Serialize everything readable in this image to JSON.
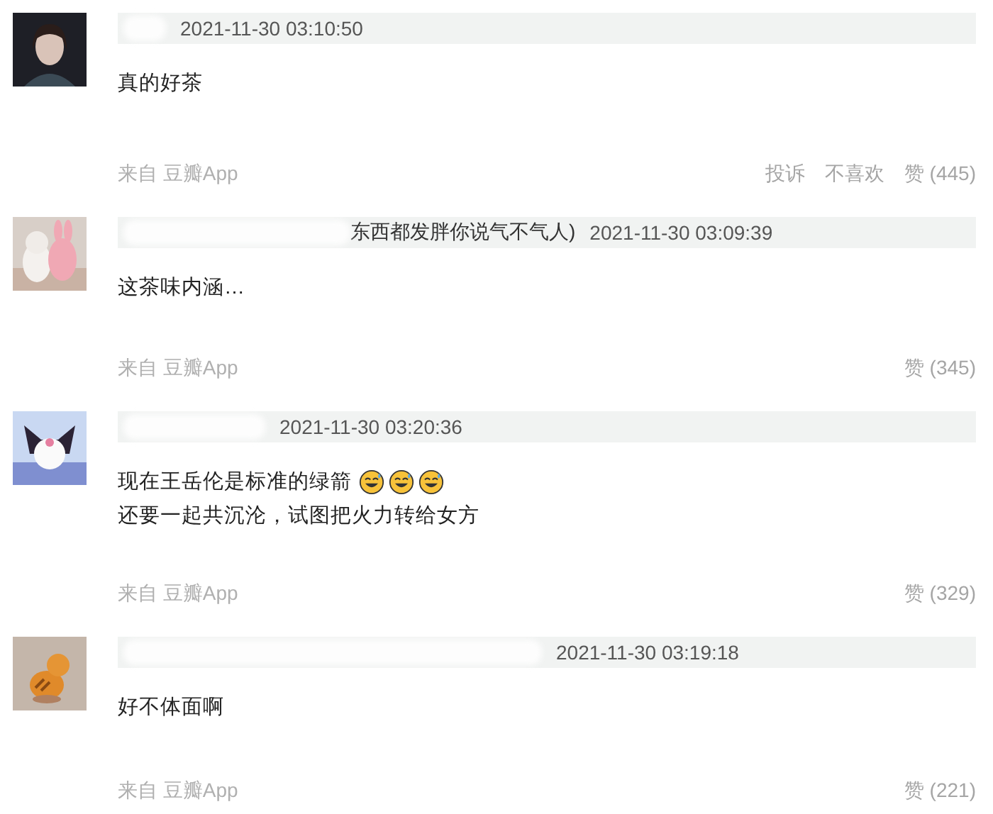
{
  "comments": [
    {
      "name_blur": {
        "kind": "short"
      },
      "time": "2021-11-30 03:10:50",
      "lines": [
        {
          "text": "真的好茶"
        }
      ],
      "source": "来自 豆瓣App",
      "actions": [
        "投诉",
        "不喜欢",
        "赞 (445)"
      ]
    },
    {
      "name_blur": {
        "kind": "medium"
      },
      "name_visible": "东西都发胖你说气不气人)",
      "time": "2021-11-30 03:09:39",
      "lines": [
        {
          "text": "这茶味内涵…"
        }
      ],
      "source": "来自 豆瓣App",
      "actions": [
        "赞 (345)"
      ]
    },
    {
      "name_blur": {
        "kind": "mid"
      },
      "time": "2021-11-30 03:20:36",
      "lines": [
        {
          "text": "现在王岳伦是标准的绿箭",
          "icons": [
            {
              "kind": "emoji"
            },
            {
              "kind": "emoji"
            },
            {
              "kind": "emoji"
            }
          ]
        },
        {
          "text": "还要一起共沉沦，试图把火力转给女方"
        }
      ],
      "source": "来自 豆瓣App",
      "actions": [
        "赞 (329)"
      ]
    },
    {
      "name_blur": {
        "kind": "long"
      },
      "time": "2021-11-30 03:19:18",
      "lines": [
        {
          "text": "好不体面啊"
        }
      ],
      "source": "来自 豆瓣App",
      "actions": [
        "赞 (221)"
      ]
    }
  ]
}
